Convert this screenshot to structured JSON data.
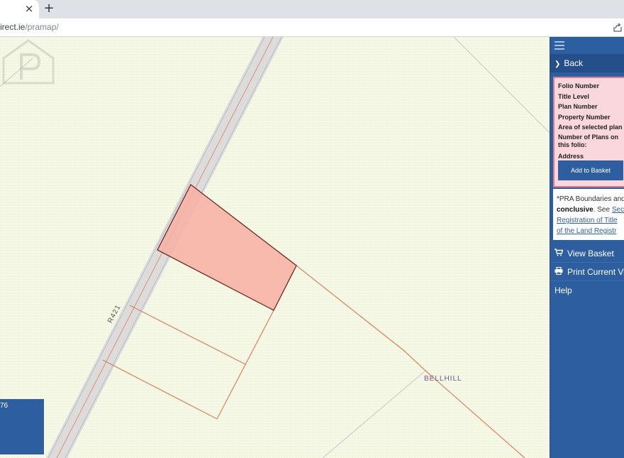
{
  "browser": {
    "tab_close": "×",
    "new_tab": "+",
    "url_prefix": "irect.ie",
    "url_path": "/pramap/"
  },
  "map": {
    "road_label": "R421",
    "place_label": "BELLHILL",
    "info_box_value": "76",
    "colors": {
      "background": "#f4f8e4",
      "parcel_fill": "#f7b2a6",
      "boundary": "#d9825c",
      "road": "#dcdcdc"
    }
  },
  "panel": {
    "menu_icon": "hamburger-icon",
    "back_label": "Back",
    "folio": {
      "folio_number": "Folio Number",
      "title_level": "Title Level",
      "plan_number": "Plan Number",
      "property_number": "Property Number",
      "area_label": "Area of selected plan",
      "plans_count_label": "Number of Plans on this folio:",
      "address": "Address",
      "add_to_basket": "Add to Basket"
    },
    "notice": {
      "line1": "*PRA Boundaries and",
      "bold": "conclusive",
      "see": ". See ",
      "link1": "Secti",
      "link2": "Registration of Title",
      "link3": "of the Land Registr"
    },
    "view_basket": "View Basket",
    "print_view": "Print Current View",
    "help": "Help"
  }
}
